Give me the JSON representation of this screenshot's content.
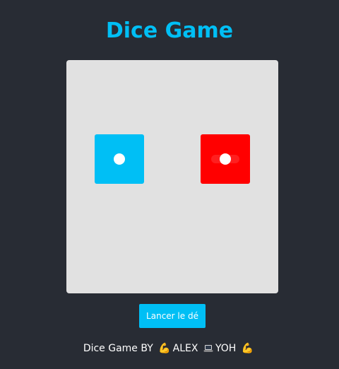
{
  "app": {
    "title": "Dice Game"
  },
  "dice": {
    "left": {
      "value": 1,
      "color": "#00bff5"
    },
    "right": {
      "value": 1,
      "color": "#ff0000"
    }
  },
  "controls": {
    "roll_label": "Lancer le dé"
  },
  "footer": {
    "prefix": "Dice Game BY",
    "author1": "ALEX",
    "author2": "YOH",
    "icons": [
      "flexed-biceps-icon",
      "laptop-icon",
      "flexed-biceps-icon"
    ]
  },
  "colors": {
    "background": "#282c34",
    "accent": "#00bff5",
    "board": "#e1e1e1",
    "die_left": "#00bff5",
    "die_right": "#ff0000"
  }
}
